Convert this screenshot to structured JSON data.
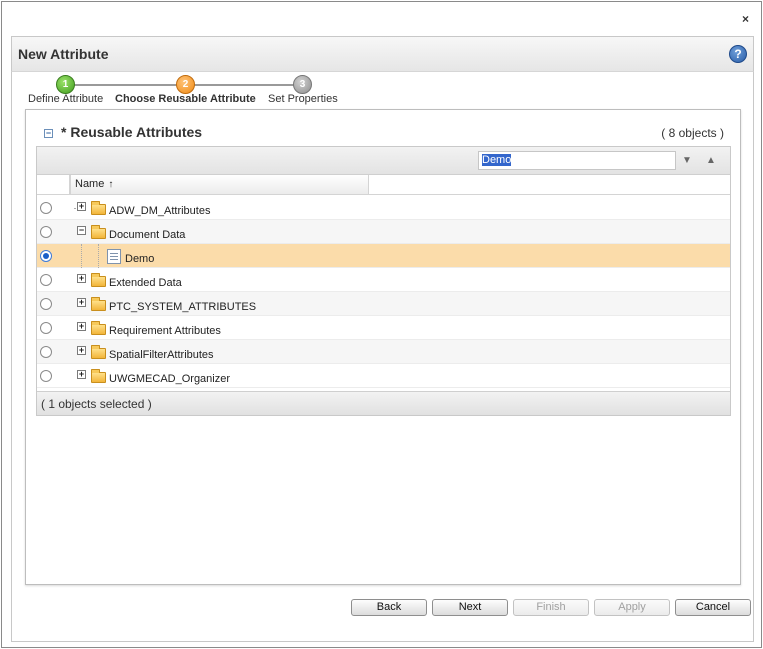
{
  "window": {
    "close_label": "×"
  },
  "header": {
    "title": "New Attribute",
    "help_label": "?"
  },
  "wizard": {
    "steps": [
      {
        "number": "1",
        "label": "Define Attribute",
        "state": "complete"
      },
      {
        "number": "2",
        "label": "Choose Reusable Attribute",
        "state": "active"
      },
      {
        "number": "3",
        "label": "Set Properties",
        "state": "pending"
      }
    ]
  },
  "section": {
    "toggle_label": "−",
    "title": "* Reusable Attributes",
    "count": "( 8 objects )"
  },
  "search": {
    "value": "Demo"
  },
  "table": {
    "column_name": "Name",
    "sort_indicator": "↑",
    "rows": [
      {
        "label": "ADW_DM_Attributes",
        "expander": "+",
        "selected": false
      },
      {
        "label": "Document Data",
        "expander": "−",
        "selected": false
      },
      {
        "label": "Demo",
        "expander": "",
        "selected": true
      },
      {
        "label": "Extended Data",
        "expander": "+",
        "selected": false
      },
      {
        "label": "PTC_SYSTEM_ATTRIBUTES",
        "expander": "+",
        "selected": false
      },
      {
        "label": "Requirement Attributes",
        "expander": "+",
        "selected": false
      },
      {
        "label": "SpatialFilterAttributes",
        "expander": "+",
        "selected": false
      },
      {
        "label": "UWGMECAD_Organizer",
        "expander": "+",
        "selected": false
      }
    ],
    "footer": "( 1 objects selected )"
  },
  "buttons": {
    "back": "Back",
    "next": "Next",
    "finish": "Finish",
    "apply": "Apply",
    "cancel": "Cancel"
  },
  "colors": {
    "selected_row": "#fbdcaa",
    "step_complete": "#3e9b1c",
    "step_active": "#f08a12",
    "step_pending": "#8e8e8e"
  }
}
